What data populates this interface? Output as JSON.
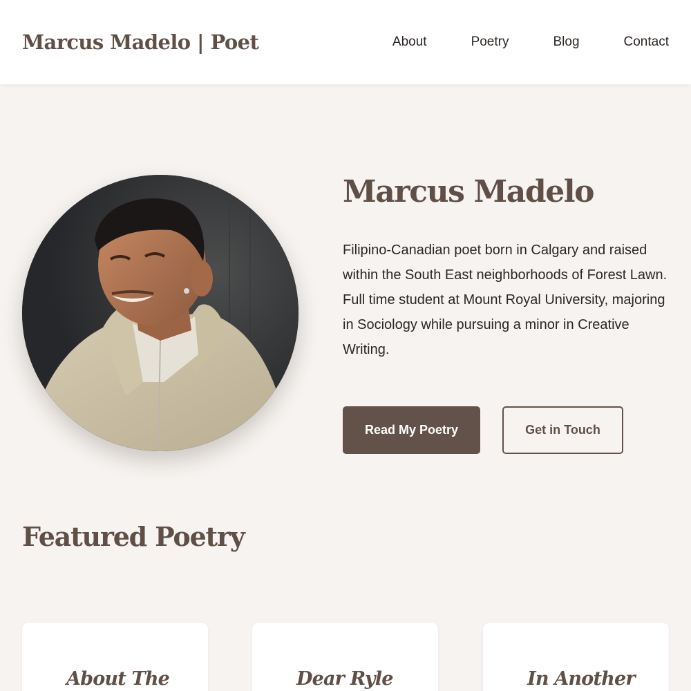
{
  "header": {
    "brand": "Marcus Madelo | Poet",
    "nav": [
      {
        "label": "About"
      },
      {
        "label": "Poetry"
      },
      {
        "label": "Blog"
      },
      {
        "label": "Contact"
      }
    ]
  },
  "hero": {
    "name": "Marcus Madelo",
    "bio": "Filipino-Canadian poet born in Calgary and raised within the South East neighborhoods of Forest Lawn. Full time student at Mount Royal University, majoring in Sociology while pursuing a minor in Creative Writing.",
    "primary_button": "Read My Poetry",
    "secondary_button": "Get in Touch",
    "portrait_icon": "portrait-photo"
  },
  "featured": {
    "title": "Featured Poetry",
    "cards": [
      {
        "title": "About The"
      },
      {
        "title": "Dear Ryle"
      },
      {
        "title": "In Another"
      }
    ]
  },
  "colors": {
    "background": "#f6f3f0",
    "header_bg": "#ffffff",
    "brand_brown": "#5f4f47",
    "button_brown": "#62524a",
    "text": "#2b2623"
  }
}
